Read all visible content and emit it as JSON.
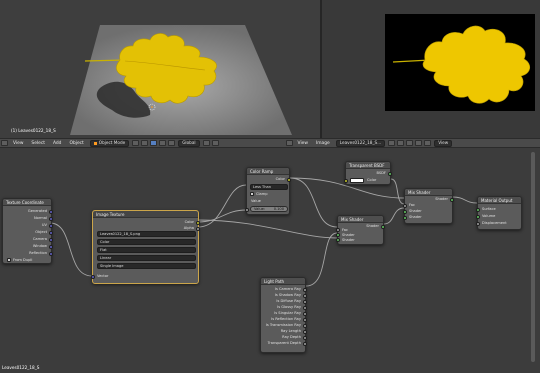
{
  "viewport": {
    "label": "(1) Leaves0122_18_S"
  },
  "header": {
    "menus": [
      "View",
      "Select",
      "Add",
      "Object"
    ],
    "mode": "Object Mode",
    "pivot": "Global",
    "right_menus": [
      "View",
      "Image"
    ],
    "image_name": "Leaves0122_18_S...",
    "view_label": "View"
  },
  "nodes": {
    "attribute": {
      "title": "Texture Coordinate",
      "outputs": [
        "Generated",
        "Normal",
        "UV",
        "Object",
        "Camera",
        "Window",
        "Reflection"
      ],
      "from_dupli": "From Dupli"
    },
    "image_texture": {
      "title": "Image Texture",
      "outputs": [
        "Color",
        "Alpha"
      ],
      "image": "Leaves0122_18_S.png",
      "color_space": "Color",
      "interpolation": "Flat",
      "extension": "Linear",
      "source": "Single Image",
      "input": "Vector"
    },
    "color_ramp": {
      "title": "Color Ramp",
      "output": "Color",
      "mode": "Less Than",
      "clamp": "Clamp",
      "inputs": [
        "Value"
      ],
      "value": "Value:",
      "value_num": "0.100"
    },
    "transparent_bsdf": {
      "title": "Transparent BSDF",
      "input": "Color",
      "output": "BSDF"
    },
    "mix_shader_1": {
      "title": "Mix Shader",
      "output": "Shader",
      "inputs": [
        "Fac",
        "Shader",
        "Shader"
      ]
    },
    "mix_shader_2": {
      "title": "Mix Shader",
      "output": "Shader",
      "inputs": [
        "Fac",
        "Shader",
        "Shader"
      ]
    },
    "material_output": {
      "title": "Material Output",
      "inputs": [
        "Surface",
        "Volume",
        "Displacement"
      ]
    },
    "light_path": {
      "title": "Light Path",
      "outputs": [
        "Is Camera Ray",
        "Is Shadow Ray",
        "Is Diffuse Ray",
        "Is Glossy Ray",
        "Is Singular Ray",
        "Is Reflection Ray",
        "Is Transmission Ray",
        "Ray Length",
        "Ray Depth",
        "Transparent Depth"
      ]
    }
  },
  "footer": {
    "material": "Leaves0122_18_S"
  },
  "colors": {
    "leaf": "#e8c200",
    "leaf_dark": "#b89400",
    "wire": "#a8a8a8",
    "select": "#cba54a"
  }
}
